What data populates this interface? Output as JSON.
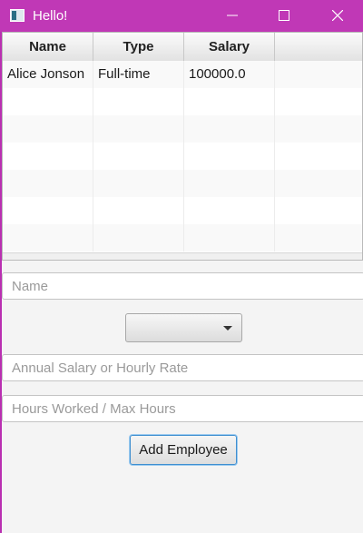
{
  "window": {
    "title": "Hello!",
    "icon": "app-window-icon",
    "title_bar_color": "#c038b6"
  },
  "table": {
    "columns": [
      "Name",
      "Type",
      "Salary",
      ""
    ],
    "rows": [
      [
        "Alice Jonson",
        "Full-time",
        "100000.0",
        ""
      ]
    ]
  },
  "form": {
    "name_placeholder": "Name",
    "type_selected": "",
    "salary_placeholder": "Annual Salary or Hourly Rate",
    "hours_placeholder": "Hours Worked / Max Hours",
    "add_button_label": "Add Employee"
  }
}
